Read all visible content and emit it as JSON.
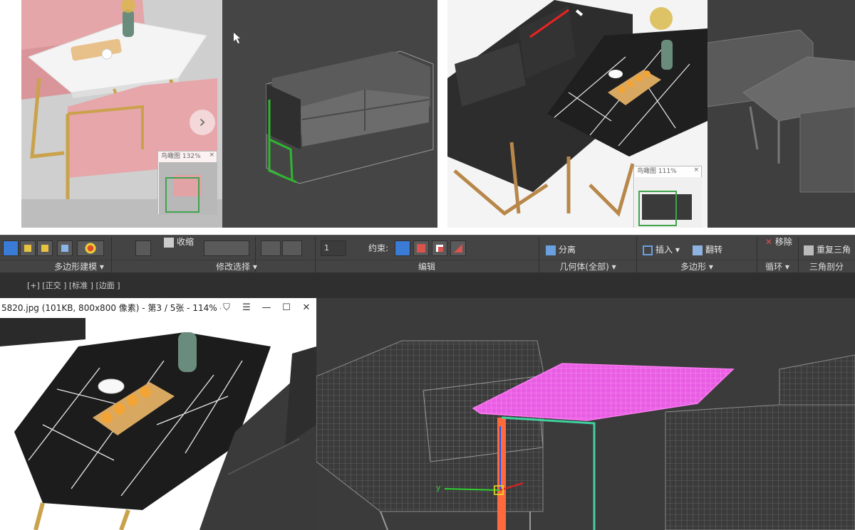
{
  "collage": {
    "nav1_label": "鸟瞰图",
    "nav1_zoom": "132%",
    "nav2_label": "鸟瞰图",
    "nav2_zoom": "111%",
    "close_glyph": "×",
    "next_glyph": "›"
  },
  "ribbon": {
    "sections": [
      "多边形建模 ▾",
      "修改选择 ▾",
      "编辑",
      "几何体(全部) ▾",
      "多边形 ▾",
      "循环 ▾",
      "三角剖分"
    ],
    "shrink_label": "收缩",
    "spinner_value": "1",
    "constraint_label": "约束:",
    "detach_label": "分离",
    "insert_label": "插入",
    "flip_label": "翻转",
    "remove_label": "移除",
    "repeat_triangulate_label": "重复三角",
    "colors": {
      "bg": "#444444",
      "accent_blue": "#4a7fc1",
      "active_btn": "#3a7bd5"
    }
  },
  "viewport": {
    "label": "[+] [正交 ] [标准 ] [边面 ]"
  },
  "viewer": {
    "title": "5820.jpg (101KB, 800x800 像素) - 第3 / 5张 - 114% - :",
    "buttons": {
      "pin": "⛉",
      "menu": "☰",
      "minimize": "—",
      "maximize": "☐",
      "close": "✕"
    }
  },
  "gizmo": {
    "y_label": "y"
  }
}
